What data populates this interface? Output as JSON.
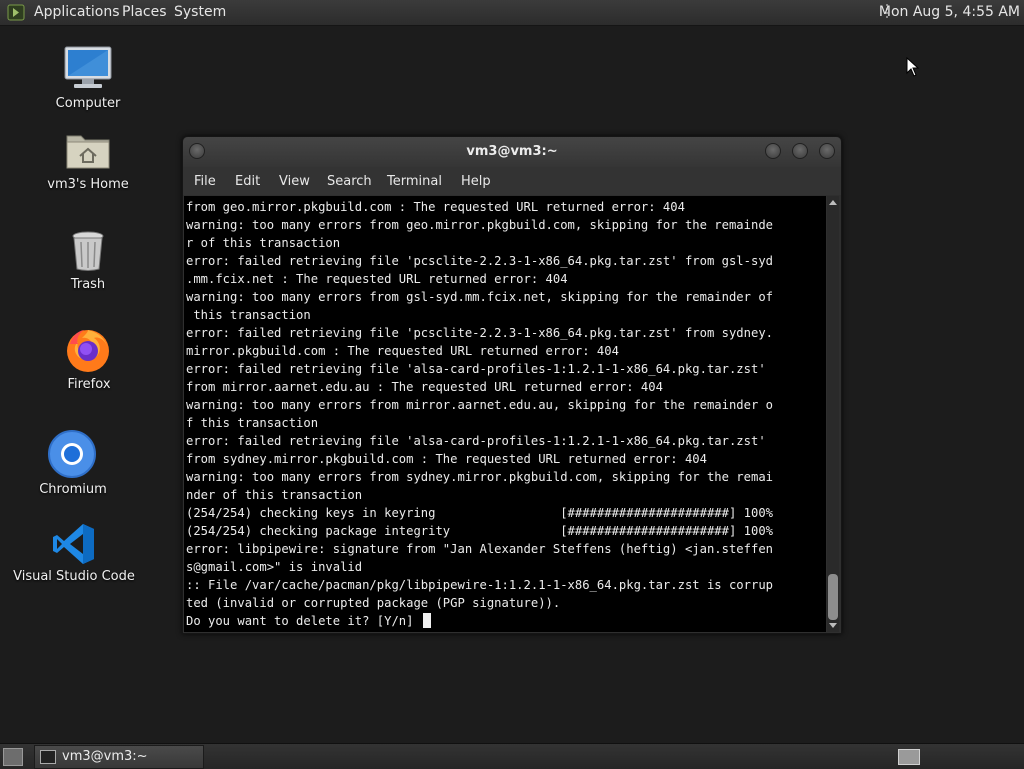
{
  "top_panel": {
    "menus": [
      "Applications",
      "Places",
      "System"
    ],
    "clock": "Mon Aug  5,  4:55 AM"
  },
  "desktop": {
    "icons": [
      {
        "label": "Computer",
        "icon": "computer-monitor-icon"
      },
      {
        "label": "vm3's Home",
        "icon": "home-folder-icon"
      },
      {
        "label": "Trash",
        "icon": "trash-icon"
      },
      {
        "label": "Firefox",
        "icon": "firefox-icon"
      },
      {
        "label": "Chromium",
        "icon": "chromium-icon"
      },
      {
        "label": "Visual Studio Code",
        "icon": "vscode-icon"
      }
    ]
  },
  "window": {
    "title": "vm3@vm3:~",
    "menu": [
      "File",
      "Edit",
      "View",
      "Search",
      "Terminal",
      "Help"
    ],
    "terminal_text": "from geo.mirror.pkgbuild.com : The requested URL returned error: 404\nwarning: too many errors from geo.mirror.pkgbuild.com, skipping for the remainde\nr of this transaction\nerror: failed retrieving file 'pcsclite-2.2.3-1-x86_64.pkg.tar.zst' from gsl-syd\n.mm.fcix.net : The requested URL returned error: 404\nwarning: too many errors from gsl-syd.mm.fcix.net, skipping for the remainder of\n this transaction\nerror: failed retrieving file 'pcsclite-2.2.3-1-x86_64.pkg.tar.zst' from sydney.\nmirror.pkgbuild.com : The requested URL returned error: 404\nerror: failed retrieving file 'alsa-card-profiles-1:1.2.1-1-x86_64.pkg.tar.zst'\nfrom mirror.aarnet.edu.au : The requested URL returned error: 404\nwarning: too many errors from mirror.aarnet.edu.au, skipping for the remainder o\nf this transaction\nerror: failed retrieving file 'alsa-card-profiles-1:1.2.1-1-x86_64.pkg.tar.zst'\nfrom sydney.mirror.pkgbuild.com : The requested URL returned error: 404\nwarning: too many errors from sydney.mirror.pkgbuild.com, skipping for the remai\nnder of this transaction\n(254/254) checking keys in keyring                 [######################] 100%\n(254/254) checking package integrity               [######################] 100%\nerror: libpipewire: signature from \"Jan Alexander Steffens (heftig) <jan.steffen\ns@gmail.com>\" is invalid\n:: File /var/cache/pacman/pkg/libpipewire-1:1.2.1-1-x86_64.pkg.tar.zst is corrup\nted (invalid or corrupted package (PGP signature)).\nDo you want to delete it? [Y/n] "
  },
  "taskbar": {
    "task_label": "vm3@vm3:~"
  }
}
